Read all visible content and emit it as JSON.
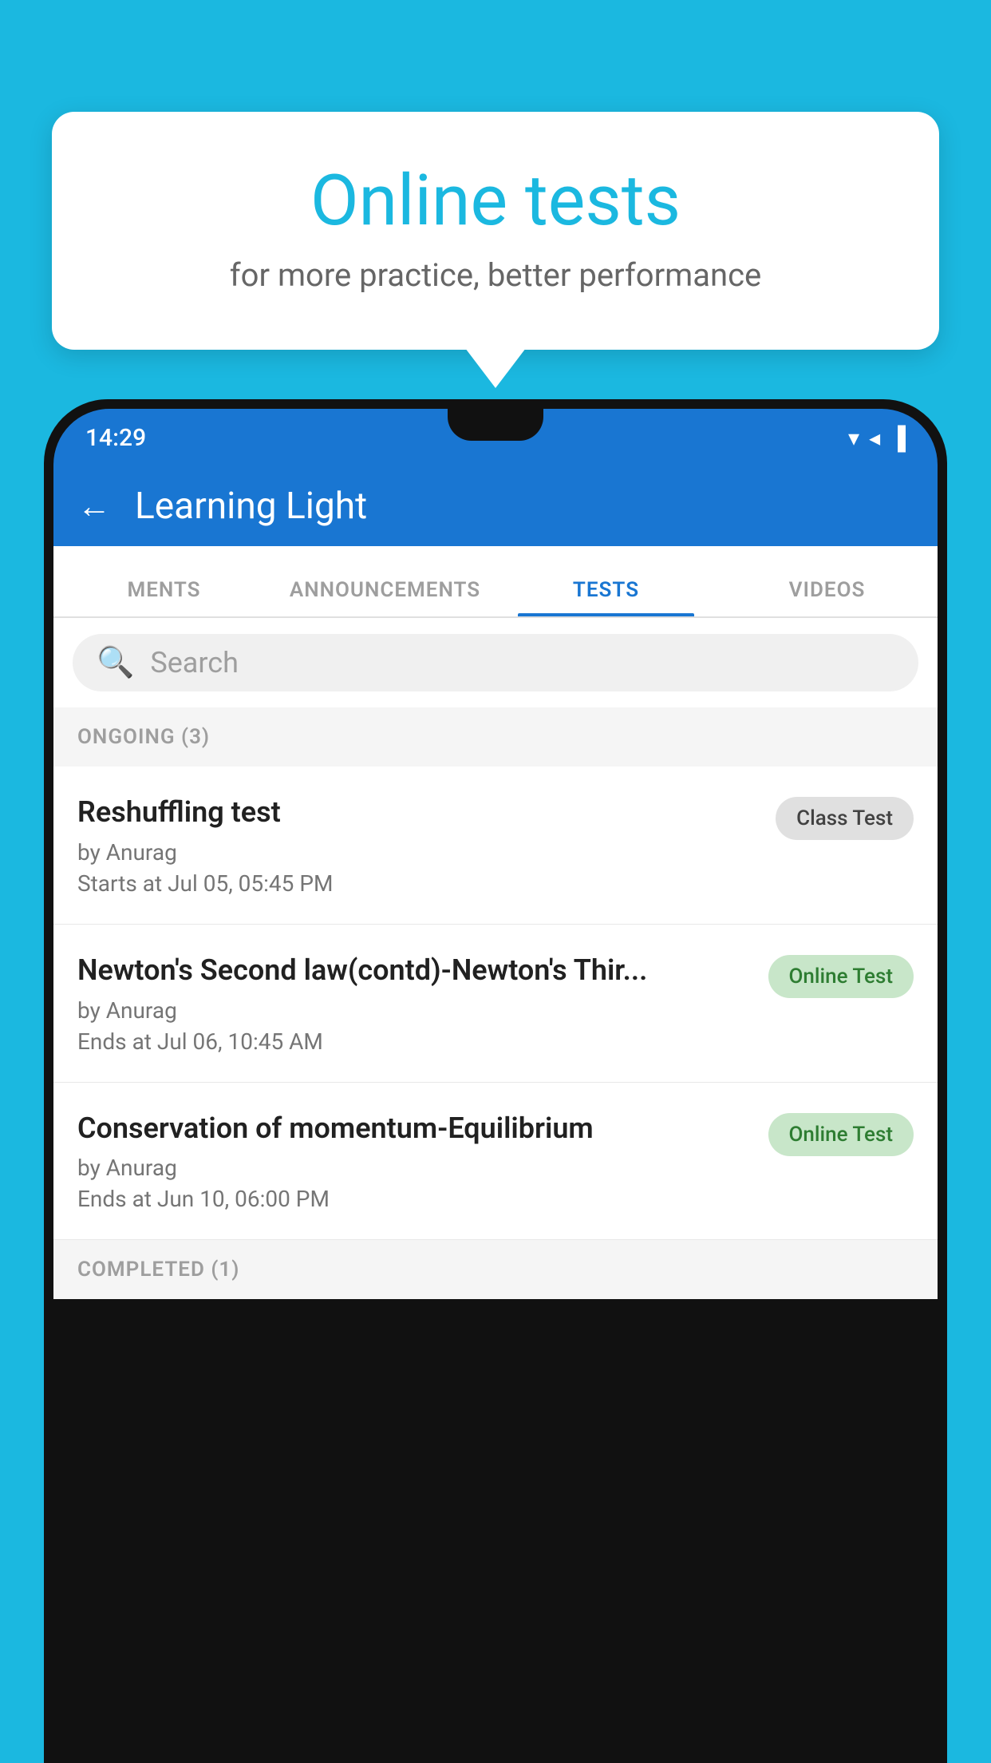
{
  "background": {
    "color": "#1bb8e0"
  },
  "bubble": {
    "title": "Online tests",
    "subtitle": "for more practice, better performance"
  },
  "phone": {
    "status_bar": {
      "time": "14:29",
      "icons": "▼◄▐"
    },
    "app_bar": {
      "title": "Learning Light",
      "back_label": "←"
    },
    "tabs": [
      {
        "label": "MENTS",
        "active": false
      },
      {
        "label": "ANNOUNCEMENTS",
        "active": false
      },
      {
        "label": "TESTS",
        "active": true
      },
      {
        "label": "VIDEOS",
        "active": false
      }
    ],
    "search": {
      "placeholder": "Search"
    },
    "sections": [
      {
        "heading": "ONGOING (3)",
        "items": [
          {
            "name": "Reshuffling test",
            "by": "by Anurag",
            "date": "Starts at  Jul 05, 05:45 PM",
            "badge": "Class Test",
            "badge_type": "class"
          },
          {
            "name": "Newton's Second law(contd)-Newton's Thir...",
            "by": "by Anurag",
            "date": "Ends at  Jul 06, 10:45 AM",
            "badge": "Online Test",
            "badge_type": "online"
          },
          {
            "name": "Conservation of momentum-Equilibrium",
            "by": "by Anurag",
            "date": "Ends at  Jun 10, 06:00 PM",
            "badge": "Online Test",
            "badge_type": "online"
          }
        ]
      },
      {
        "heading": "COMPLETED (1)",
        "items": []
      }
    ]
  }
}
